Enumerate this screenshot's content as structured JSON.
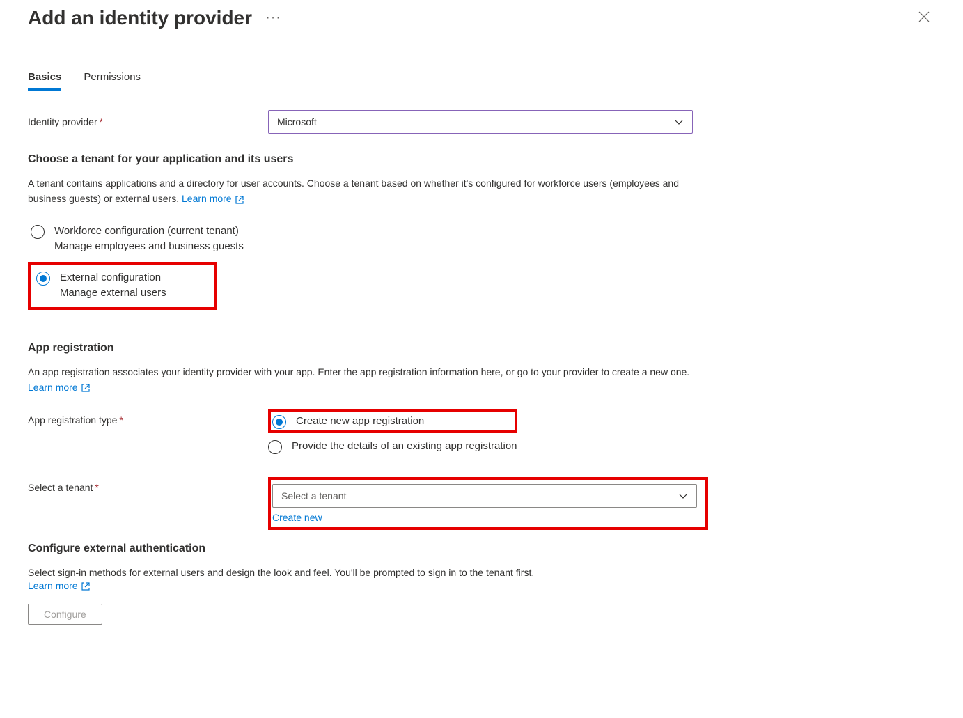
{
  "header": {
    "title": "Add an identity provider"
  },
  "tabs": {
    "basics": "Basics",
    "permissions": "Permissions"
  },
  "identityProvider": {
    "label": "Identity provider",
    "value": "Microsoft"
  },
  "tenantSection": {
    "heading": "Choose a tenant for your application and its users",
    "description": "A tenant contains applications and a directory for user accounts. Choose a tenant based on whether it's configured for workforce users (employees and business guests) or external users. ",
    "learnMore": "Learn more",
    "workforce": {
      "title": "Workforce configuration (current tenant)",
      "subtitle": "Manage employees and business guests"
    },
    "external": {
      "title": "External configuration",
      "subtitle": "Manage external users"
    }
  },
  "appRegistration": {
    "heading": "App registration",
    "description": "An app registration associates your identity provider with your app. Enter the app registration information here, or go to your provider to create a new one. ",
    "learnMore": "Learn more",
    "typeLabel": "App registration type",
    "createNew": "Create new app registration",
    "provideExisting": "Provide the details of an existing app registration",
    "selectTenantLabel": "Select a tenant",
    "selectTenantPlaceholder": "Select a tenant",
    "createNewLink": "Create new"
  },
  "configureAuth": {
    "heading": "Configure external authentication",
    "description": "Select sign-in methods for external users and design the look and feel. You'll be prompted to sign in to the tenant first.",
    "learnMore": "Learn more",
    "button": "Configure"
  }
}
